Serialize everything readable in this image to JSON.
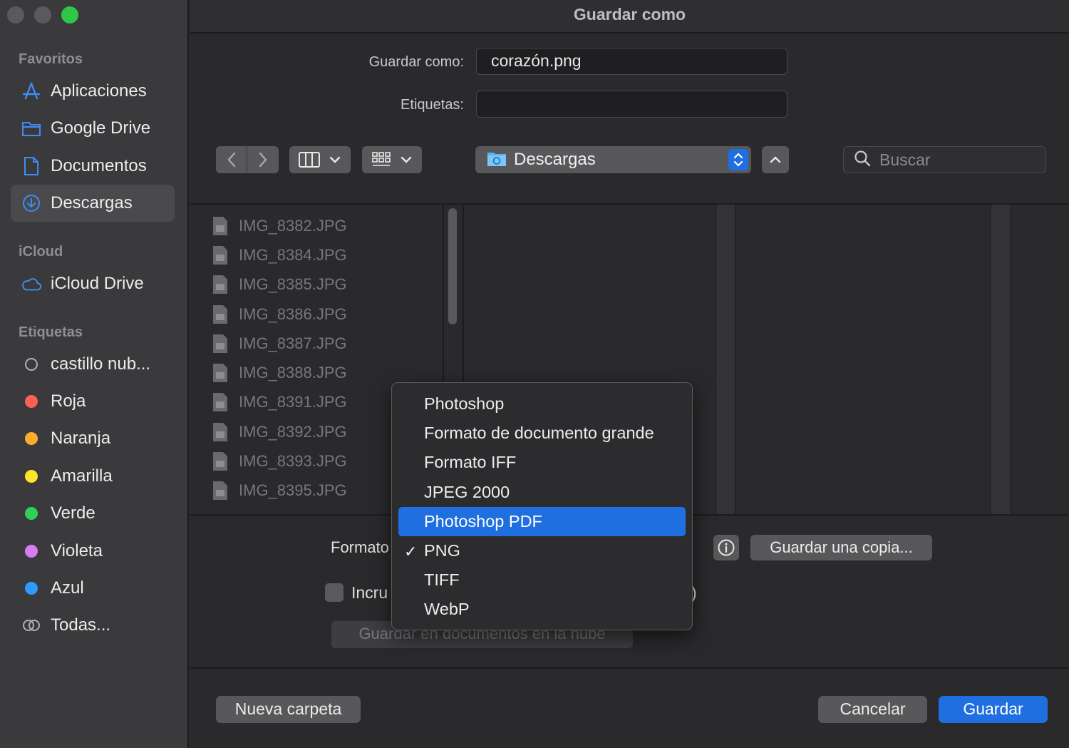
{
  "window": {
    "title": "Guardar como"
  },
  "sidebar": {
    "favorites_header": "Favoritos",
    "favorites": [
      {
        "label": "Aplicaciones",
        "icon": "apps-icon"
      },
      {
        "label": "Google Drive",
        "icon": "folder-icon"
      },
      {
        "label": "Documentos",
        "icon": "document-icon"
      },
      {
        "label": "Descargas",
        "icon": "download-icon",
        "selected": true
      }
    ],
    "icloud_header": "iCloud",
    "icloud": [
      {
        "label": "iCloud Drive",
        "icon": "cloud-icon"
      }
    ],
    "tags_header": "Etiquetas",
    "tags": [
      {
        "label": "castillo nub...",
        "color": ""
      },
      {
        "label": "Roja",
        "color": "#fe5f57"
      },
      {
        "label": "Naranja",
        "color": "#fdac2b"
      },
      {
        "label": "Amarilla",
        "color": "#fde52c"
      },
      {
        "label": "Verde",
        "color": "#2ed158"
      },
      {
        "label": "Violeta",
        "color": "#d87cf3"
      },
      {
        "label": "Azul",
        "color": "#2e9bff"
      },
      {
        "label": "Todas...",
        "color": ""
      }
    ]
  },
  "form": {
    "save_as_label": "Guardar como:",
    "save_as_value": "corazón.png",
    "tags_label": "Etiquetas:",
    "tags_value": ""
  },
  "toolbar": {
    "location": "Descargas",
    "search_placeholder": "Buscar"
  },
  "files": [
    "IMG_8382.JPG",
    "IMG_8384.JPG",
    "IMG_8385.JPG",
    "IMG_8386.JPG",
    "IMG_8387.JPG",
    "IMG_8388.JPG",
    "IMG_8391.JPG",
    "IMG_8392.JPG",
    "IMG_8393.JPG",
    "IMG_8395.JPG"
  ],
  "options": {
    "format_label": "Formato",
    "checkbox_label": "Incru",
    "checkbox_tail": ")",
    "cloud_button": "Guardar en documentos en la nube",
    "copy_button": "Guardar una copia..."
  },
  "format_menu": {
    "items": [
      {
        "label": "Photoshop",
        "checked": false,
        "highlighted": false
      },
      {
        "label": "Formato de documento grande",
        "checked": false,
        "highlighted": false
      },
      {
        "label": "Formato IFF",
        "checked": false,
        "highlighted": false
      },
      {
        "label": "JPEG 2000",
        "checked": false,
        "highlighted": false
      },
      {
        "label": "Photoshop PDF",
        "checked": false,
        "highlighted": true
      },
      {
        "label": "PNG",
        "checked": true,
        "highlighted": false
      },
      {
        "label": "TIFF",
        "checked": false,
        "highlighted": false
      },
      {
        "label": "WebP",
        "checked": false,
        "highlighted": false
      }
    ],
    "check_glyph": "✓"
  },
  "footer": {
    "new_folder": "Nueva carpeta",
    "cancel": "Cancelar",
    "save": "Guardar"
  },
  "colors": {
    "accent": "#1f6fe0",
    "traffic_green": "#2fc748"
  }
}
